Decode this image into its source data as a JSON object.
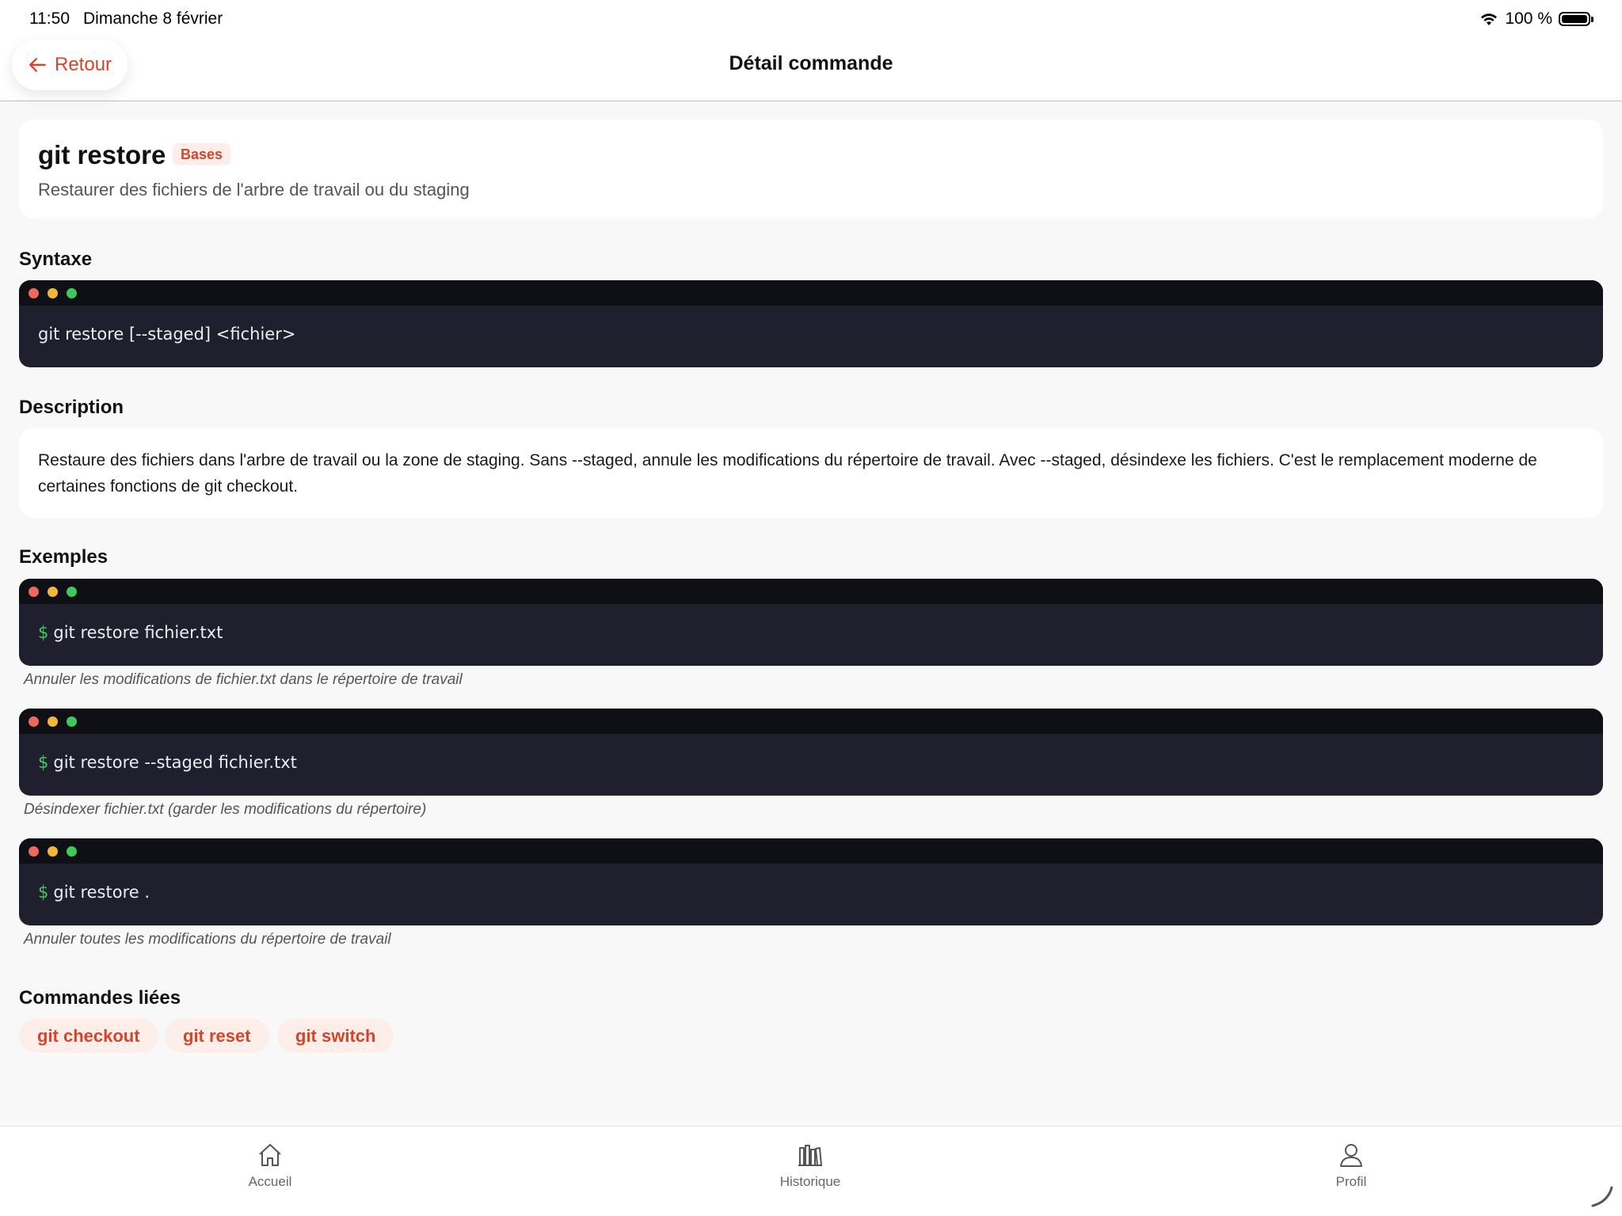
{
  "status_bar": {
    "time": "11:50",
    "date": "Dimanche 8 février",
    "battery": "100 %",
    "icons": [
      "wifi-icon",
      "battery-icon"
    ]
  },
  "nav": {
    "back_label": "Retour",
    "title": "Détail commande",
    "accent_color": "#d4452b"
  },
  "command": {
    "name": "git restore",
    "badge": "Bases",
    "subtitle": "Restaurer des fichiers de l'arbre de travail ou du staging"
  },
  "sections": {
    "syntax": "Syntaxe",
    "description": "Description",
    "examples": "Exemples",
    "related": "Commandes liées"
  },
  "syntax_code": "git restore [--staged] <fichier>",
  "description_text": "Restaure des fichiers dans l'arbre de travail ou la zone de staging. Sans --staged, annule les modifications du répertoire de travail. Avec --staged, désindexe les fichiers. C'est le remplacement moderne de certaines fonctions de git checkout.",
  "examples": [
    {
      "prompt": "$",
      "code": "git restore fichier.txt",
      "caption": "Annuler les modifications de fichier.txt dans le répertoire de travail"
    },
    {
      "prompt": "$",
      "code": "git restore --staged fichier.txt",
      "caption": "Désindexer fichier.txt (garder les modifications du répertoire)"
    },
    {
      "prompt": "$",
      "code": "git restore .",
      "caption": "Annuler toutes les modifications du répertoire de travail"
    }
  ],
  "related_commands": [
    "git checkout",
    "git reset",
    "git switch"
  ],
  "tabbar": {
    "items": [
      {
        "label": "Accueil",
        "icon": "home-icon"
      },
      {
        "label": "Historique",
        "icon": "library-icon"
      },
      {
        "label": "Profil",
        "icon": "person-icon"
      }
    ]
  }
}
